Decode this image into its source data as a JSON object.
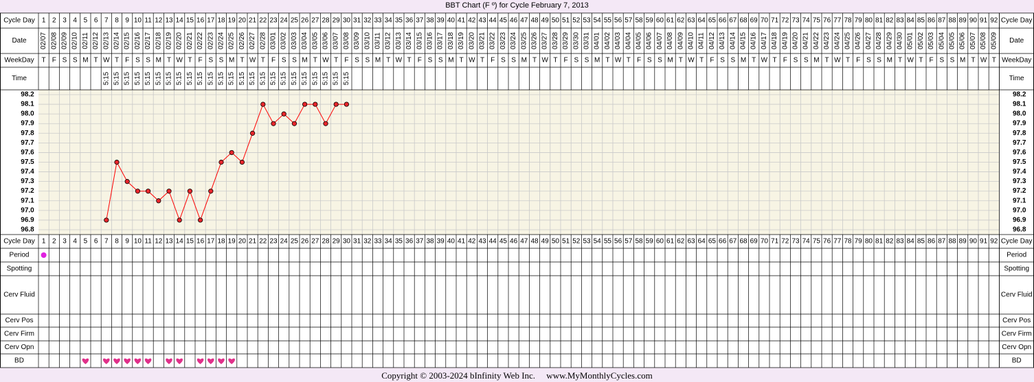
{
  "title": "BBT Chart (F º) for Cycle February 7, 2013",
  "copyright": "Copyright © 2003-2024 bInfinity Web Inc.     www.MyMonthlyCycles.com",
  "colors": {
    "background": "#f4e8f6",
    "grid_area": "#f7f4e4",
    "grid_line": "#c9c9c9",
    "line": "#ff0000",
    "point_fill": "#e8262c",
    "period": "#e020e0",
    "heart": "#e0308a"
  },
  "row_labels": {
    "cycle_day": "Cycle Day",
    "date": "Date",
    "weekday": "WeekDay",
    "time": "Time",
    "period": "Period",
    "spotting": "Spotting",
    "cerv_fluid": "Cerv Fluid",
    "cerv_pos": "Cerv Pos",
    "cerv_firm": "Cerv Firm",
    "cerv_opn": "Cerv Opn",
    "bd": "BD"
  },
  "chart_data": {
    "type": "line",
    "title": "BBT Chart (F º) for Cycle February 7, 2013",
    "cycle_days": [
      1,
      2,
      3,
      4,
      5,
      6,
      7,
      8,
      9,
      10,
      11,
      12,
      13,
      14,
      15,
      16,
      17,
      18,
      19,
      20,
      21,
      22,
      23,
      24,
      25,
      26,
      27,
      28,
      29,
      30,
      31,
      32,
      33,
      34,
      35,
      36,
      37,
      38,
      39,
      40,
      41,
      42,
      43,
      44,
      45,
      46,
      47,
      48,
      49,
      50,
      51,
      52,
      53,
      54,
      55,
      56,
      57,
      58,
      59,
      60,
      61,
      62,
      63,
      64,
      65,
      66,
      67,
      68,
      69,
      70,
      71,
      72,
      73,
      74,
      75,
      76,
      77,
      78,
      79,
      80,
      81,
      82,
      83,
      84,
      85,
      86,
      87,
      88,
      89,
      90,
      91,
      92
    ],
    "dates": [
      "02/07",
      "02/08",
      "02/09",
      "02/10",
      "02/11",
      "02/12",
      "02/13",
      "02/14",
      "02/15",
      "02/16",
      "02/17",
      "02/18",
      "02/19",
      "02/20",
      "02/21",
      "02/22",
      "02/23",
      "02/24",
      "02/25",
      "02/26",
      "02/27",
      "02/28",
      "03/01",
      "03/02",
      "03/03",
      "03/04",
      "03/05",
      "03/06",
      "03/07",
      "03/08",
      "03/09",
      "03/10",
      "03/11",
      "03/12",
      "03/13",
      "03/14",
      "03/15",
      "03/16",
      "03/17",
      "03/18",
      "03/19",
      "03/20",
      "03/21",
      "03/22",
      "03/23",
      "03/24",
      "03/25",
      "03/26",
      "03/27",
      "03/28",
      "03/29",
      "03/30",
      "03/31",
      "04/01",
      "04/02",
      "04/03",
      "04/04",
      "04/05",
      "04/06",
      "04/07",
      "04/08",
      "04/09",
      "04/10",
      "04/11",
      "04/12",
      "04/13",
      "04/14",
      "04/15",
      "04/16",
      "04/17",
      "04/18",
      "04/19",
      "04/20",
      "04/21",
      "04/22",
      "04/23",
      "04/24",
      "04/25",
      "04/26",
      "04/27",
      "04/28",
      "04/29",
      "04/30",
      "05/01",
      "05/02",
      "05/03",
      "05/04",
      "05/05",
      "05/06",
      "05/07",
      "05/08",
      "05/09"
    ],
    "weekdays": [
      "T",
      "F",
      "S",
      "S",
      "M",
      "T",
      "W",
      "T",
      "F",
      "S",
      "S",
      "M",
      "T",
      "W",
      "T",
      "F",
      "S",
      "S",
      "M",
      "T",
      "W",
      "T",
      "F",
      "S",
      "S",
      "M",
      "T",
      "W",
      "T",
      "F",
      "S",
      "S",
      "M",
      "T",
      "W",
      "T",
      "F",
      "S",
      "S",
      "M",
      "T",
      "W",
      "T",
      "F",
      "S",
      "S",
      "M",
      "T",
      "W",
      "T",
      "F",
      "S",
      "S",
      "M",
      "T",
      "W",
      "T",
      "F",
      "S",
      "S",
      "M",
      "T",
      "W",
      "T",
      "F",
      "S",
      "S",
      "M",
      "T",
      "W",
      "T",
      "F",
      "S",
      "S",
      "M",
      "T",
      "W",
      "T",
      "F",
      "S",
      "S",
      "M",
      "T",
      "W",
      "T",
      "F",
      "S",
      "S",
      "M",
      "T",
      "W",
      "T"
    ],
    "times": [
      "",
      "",
      "",
      "",
      "",
      "",
      "5:15",
      "5:15",
      "5:15",
      "5:15",
      "5:15",
      "5:15",
      "5:15",
      "5:15",
      "5:15",
      "5:15",
      "5:15",
      "5:15",
      "5:15",
      "5:15",
      "5:15",
      "5:15",
      "5:15",
      "5:15",
      "5:15",
      "5:15",
      "5:15",
      "5:15",
      "5:15",
      "5:15"
    ],
    "temp_ticks": [
      "98.2",
      "98.1",
      "98.0",
      "97.9",
      "97.8",
      "97.7",
      "97.6",
      "97.5",
      "97.4",
      "97.3",
      "97.2",
      "97.1",
      "97.0",
      "96.9",
      "96.8"
    ],
    "ylim": [
      96.8,
      98.2
    ],
    "temps": [
      null,
      null,
      null,
      null,
      null,
      null,
      96.9,
      97.5,
      97.3,
      97.2,
      97.2,
      97.1,
      97.2,
      96.9,
      97.2,
      96.9,
      97.2,
      97.5,
      97.6,
      97.5,
      97.8,
      98.1,
      97.9,
      98.0,
      97.9,
      98.1,
      98.1,
      97.9,
      98.1,
      98.1
    ],
    "period_days": [
      1
    ],
    "bd_days": [
      5,
      7,
      8,
      9,
      10,
      11,
      13,
      14,
      16,
      17,
      18,
      19
    ]
  }
}
